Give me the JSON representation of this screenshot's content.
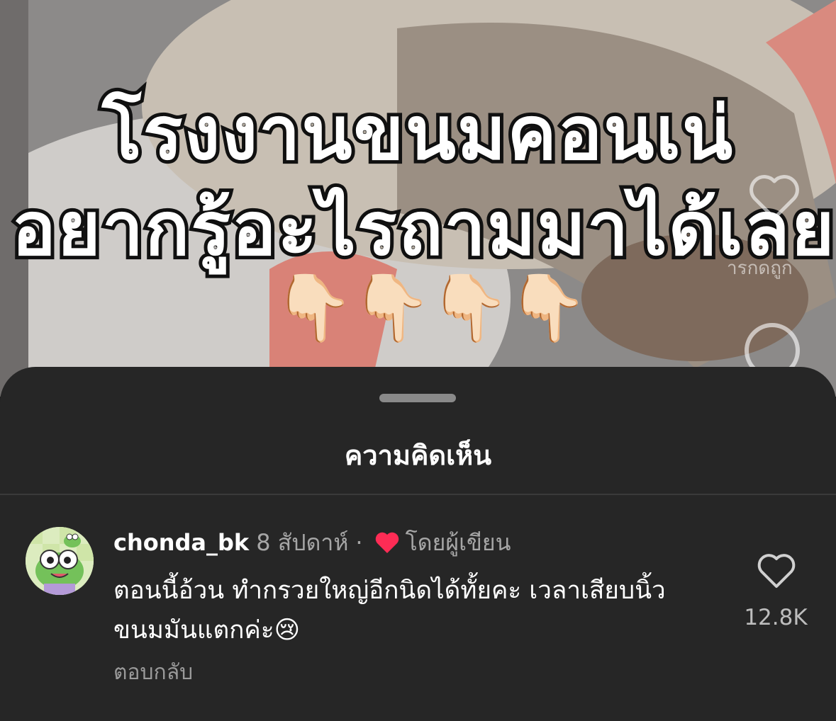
{
  "video": {
    "caption_line1": "โรงงานขนมคอนเน่",
    "caption_line2": "อยากรู้อะไรถามมาได้เลย",
    "pointer_emoji": "👇🏻",
    "side_label": "ารกดถูก",
    "icons": [
      "heart-outline-icon",
      "comment-bubble-icon"
    ]
  },
  "sheet": {
    "title": "ความคิดเห็น"
  },
  "comment": {
    "username": "chonda_bk",
    "time": "8 สัปดาห์",
    "separator": "·",
    "liked_by_author": "โดยผู้เขียน",
    "text": "ตอนนี้อ้วน ทำกรวยใหญ่อีกนิดได้ทั้ยคะ เวลาเสียบนิ้ว ขนมมันแตกค่ะ😢",
    "like_count": "12.8K",
    "reply_label": "ตอบกลับ"
  },
  "colors": {
    "sheet_bg": "#262626",
    "heart_red": "#fe2c55",
    "muted_text": "#a6a6a6"
  }
}
